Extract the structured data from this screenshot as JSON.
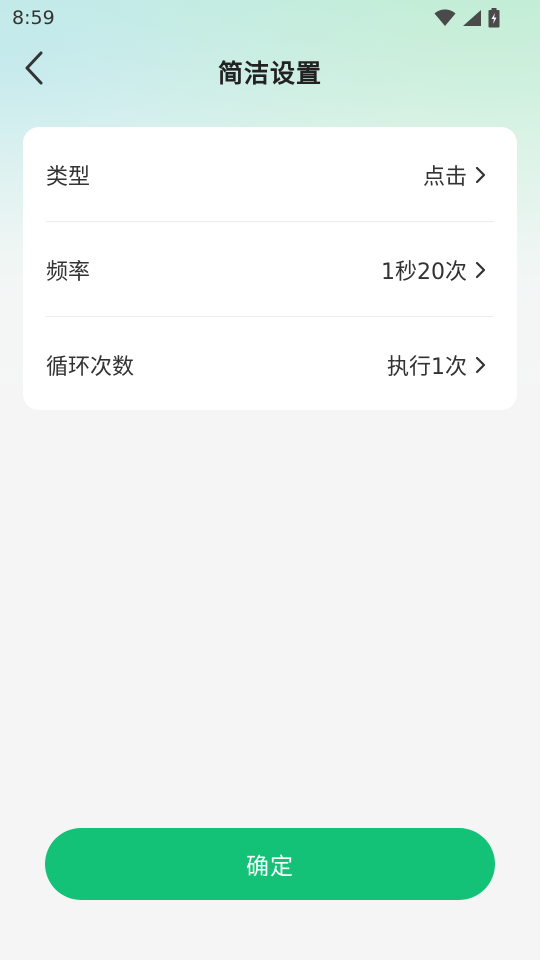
{
  "status_bar": {
    "time": "8:59",
    "icons": [
      "wifi-icon",
      "signal-icon",
      "battery-charging-icon"
    ]
  },
  "header": {
    "back_icon": "chevron-left-icon",
    "title": "简洁设置"
  },
  "settings": [
    {
      "label": "类型",
      "value": "点击"
    },
    {
      "label": "频率",
      "value": "1秒20次"
    },
    {
      "label": "循环次数",
      "value": "执行1次"
    }
  ],
  "confirm_label": "确定",
  "colors": {
    "primary": "#14c277",
    "text": "#333333",
    "card": "#ffffff",
    "background": "#f5f5f5"
  }
}
